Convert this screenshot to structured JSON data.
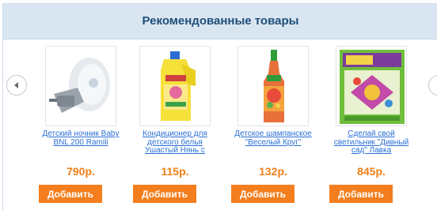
{
  "widget": {
    "title": "Рекомендованные товары"
  },
  "nav": {
    "prev_icon": "chevron-left-icon",
    "next_icon": "chevron-right-icon"
  },
  "products": [
    {
      "name": "Детский ночник Baby BNL 200 Ramili",
      "price": "790р.",
      "button": "Добавить",
      "image": "night-light"
    },
    {
      "name": "Кондиционер для детского белья Ушастый Нянь с",
      "price": "115р.",
      "button": "Добавить",
      "image": "detergent-bottle"
    },
    {
      "name": "Детское шампанское \"Веселый Круг\"",
      "price": "132р.",
      "button": "Добавить",
      "image": "kids-champagne"
    },
    {
      "name": "Сделай свой светильник \"Дивный сад\" Лавка",
      "price": "845р.",
      "button": "Добавить",
      "image": "craft-box"
    }
  ],
  "colors": {
    "header_bg": "#d9e6f2",
    "title": "#1f4e79",
    "link": "#2a6fd6",
    "price": "#f07f16",
    "button": "#f47e1d"
  }
}
